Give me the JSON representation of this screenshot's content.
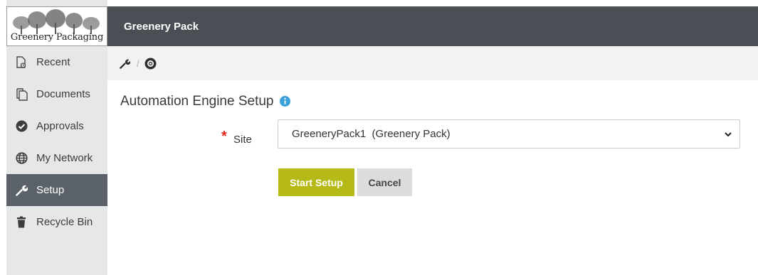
{
  "logo": {
    "text": "Greenery Packaging"
  },
  "header": {
    "title": "Greenery Pack"
  },
  "breadcrumb": {
    "separator": "/",
    "items": [
      "wrench-icon",
      "gear-icon"
    ]
  },
  "sidebar": {
    "items": [
      {
        "label": "Recent",
        "icon": "recent-doc-icon",
        "active": false
      },
      {
        "label": "Documents",
        "icon": "documents-icon",
        "active": false
      },
      {
        "label": "Approvals",
        "icon": "check-circle-icon",
        "active": false
      },
      {
        "label": "My Network",
        "icon": "globe-icon",
        "active": false
      },
      {
        "label": "Setup",
        "icon": "wrench-icon",
        "active": true
      },
      {
        "label": "Recycle Bin",
        "icon": "trash-icon",
        "active": false
      }
    ]
  },
  "main": {
    "title": "Automation Engine Setup",
    "site": {
      "required_marker": "*",
      "label": "Site",
      "selected": "GreeneryPack1  (Greenery Pack)"
    },
    "buttons": {
      "start": "Start Setup",
      "cancel": "Cancel"
    }
  },
  "colors": {
    "header_bg": "#4a4f55",
    "sidebar_bg": "#e6e7e8",
    "active_item_bg": "#5b6168",
    "primary_button": "#b5ba19",
    "info_icon": "#3aa0d8",
    "required_star": "#d9261c"
  }
}
